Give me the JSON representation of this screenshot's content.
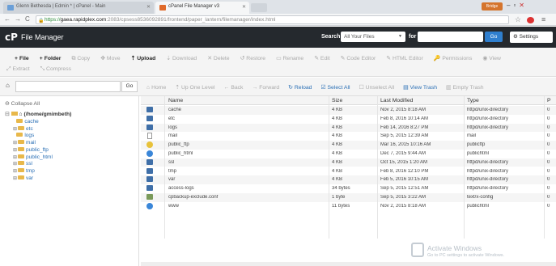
{
  "browser": {
    "tabs": [
      {
        "label": "Glenn Bethesda | Edmin *  |  cPanel - Main",
        "active": false
      },
      {
        "label": "cPanel File Manager v3",
        "active": true
      }
    ],
    "user_badge": "Bridge",
    "url": {
      "scheme": "https://",
      "host": "gaea.rapidplex.com",
      "path": ":2083/cpsess8536092891/frontend/paper_lantern/filemanager/index.html"
    }
  },
  "header": {
    "logo": "cP",
    "title": "File Manager",
    "search_label": "Search",
    "search_scope": "All Your Files",
    "for_label": "for",
    "go_label": "Go",
    "settings_label": "Settings"
  },
  "toolbar": {
    "row1": [
      {
        "icon": "+",
        "label": "File",
        "enabled": true
      },
      {
        "icon": "+",
        "label": "Folder",
        "enabled": true
      },
      {
        "icon": "⧉",
        "label": "Copy",
        "enabled": false
      },
      {
        "icon": "✥",
        "label": "Move",
        "enabled": false
      },
      {
        "icon": "⇡",
        "label": "Upload",
        "enabled": true
      },
      {
        "icon": "⇣",
        "label": "Download",
        "enabled": false
      },
      {
        "icon": "✕",
        "label": "Delete",
        "enabled": false
      },
      {
        "icon": "↺",
        "label": "Restore",
        "enabled": false
      },
      {
        "icon": "▭",
        "label": "Rename",
        "enabled": false
      },
      {
        "icon": "✎",
        "label": "Edit",
        "enabled": false
      },
      {
        "icon": "✎",
        "label": "Code Editor",
        "enabled": false
      },
      {
        "icon": "✎",
        "label": "HTML Editor",
        "enabled": false
      },
      {
        "icon": "🔑",
        "label": "Permissions",
        "enabled": false
      },
      {
        "icon": "◉",
        "label": "View",
        "enabled": false
      }
    ],
    "row2": [
      {
        "icon": "⤢",
        "label": "Extract",
        "enabled": false
      },
      {
        "icon": "⤡",
        "label": "Compress",
        "enabled": false
      }
    ]
  },
  "pathbar": {
    "go_label": "Go",
    "nav": [
      {
        "icon": "⌂",
        "label": "Home",
        "enabled": false
      },
      {
        "icon": "⇡",
        "label": "Up One Level",
        "enabled": false
      },
      {
        "icon": "←",
        "label": "Back",
        "enabled": false
      },
      {
        "icon": "→",
        "label": "Forward",
        "enabled": false
      },
      {
        "icon": "↻",
        "label": "Reload",
        "enabled": true
      },
      {
        "icon": "☑",
        "label": "Select All",
        "enabled": true
      },
      {
        "icon": "☐",
        "label": "Unselect All",
        "enabled": false
      },
      {
        "icon": "▤",
        "label": "View Trash",
        "enabled": true
      },
      {
        "icon": "▥",
        "label": "Empty Trash",
        "enabled": false
      }
    ]
  },
  "tree": {
    "collapse_label": "Collapse All",
    "root_label": "(/home/gmimbeth)",
    "nodes": [
      {
        "label": "cache",
        "expandable": false
      },
      {
        "label": "etc",
        "expandable": true
      },
      {
        "label": "logs",
        "expandable": false
      },
      {
        "label": "mail",
        "expandable": true
      },
      {
        "label": "public_ftp",
        "expandable": true
      },
      {
        "label": "public_html",
        "expandable": true
      },
      {
        "label": "ssl",
        "expandable": true
      },
      {
        "label": "tmp",
        "expandable": true
      },
      {
        "label": "var",
        "expandable": true
      }
    ]
  },
  "table": {
    "columns": [
      "Name",
      "Size",
      "Last Modified",
      "Type",
      "P"
    ],
    "rows": [
      {
        "icon": "folder",
        "name": "cache",
        "size": "4 KB",
        "modified": "Nov 2, 2015 8:18 AM",
        "type": "httpd/unix-directory",
        "perm": "0"
      },
      {
        "icon": "folder",
        "name": "etc",
        "size": "4 KB",
        "modified": "Feb 8, 2016 10:14 AM",
        "type": "httpd/unix-directory",
        "perm": "0"
      },
      {
        "icon": "folder",
        "name": "logs",
        "size": "4 KB",
        "modified": "Feb 14, 2016 8:27 PM",
        "type": "httpd/unix-directory",
        "perm": "0"
      },
      {
        "icon": "file",
        "name": "mail",
        "size": "4 KB",
        "modified": "Sep 5, 2015 12:39 AM",
        "type": "mail",
        "perm": "0"
      },
      {
        "icon": "ftp",
        "name": "public_ftp",
        "size": "4 KB",
        "modified": "Mar 16, 2015 10:16 AM",
        "type": "publicftp",
        "perm": "0"
      },
      {
        "icon": "globe",
        "name": "public_html",
        "size": "4 KB",
        "modified": "Dec 7, 2015 9:44 AM",
        "type": "publichtml",
        "perm": "0"
      },
      {
        "icon": "folder",
        "name": "ssl",
        "size": "4 KB",
        "modified": "Oct 15, 2015 1:20 AM",
        "type": "httpd/unix-directory",
        "perm": "0"
      },
      {
        "icon": "folder",
        "name": "tmp",
        "size": "4 KB",
        "modified": "Feb 8, 2016 12:10 PM",
        "type": "httpd/unix-directory",
        "perm": "0"
      },
      {
        "icon": "folder",
        "name": "var",
        "size": "4 KB",
        "modified": "Feb 5, 2016 10:15 AM",
        "type": "httpd/unix-directory",
        "perm": "0"
      },
      {
        "icon": "folder",
        "name": "access-logs",
        "size": "34 bytes",
        "modified": "Sep 5, 2015 12:51 AM",
        "type": "httpd/unix-directory",
        "perm": "0"
      },
      {
        "icon": "conf",
        "name": "cpbackup-exclude.conf",
        "size": "1 byte",
        "modified": "Sep 5, 2015 3:22 AM",
        "type": "text/x-config",
        "perm": "0"
      },
      {
        "icon": "globe",
        "name": "www",
        "size": "11 bytes",
        "modified": "Nov 2, 2015 8:18 AM",
        "type": "publichtml",
        "perm": "0"
      }
    ]
  },
  "watermark": {
    "line1": "Activate Windows",
    "line2": "Go to PC settings to activate Windows."
  },
  "colors": {
    "header_bg": "#25292e",
    "go_button": "#2f7fcf",
    "link": "#2a6fb5",
    "folder": "#3f6fa8"
  }
}
